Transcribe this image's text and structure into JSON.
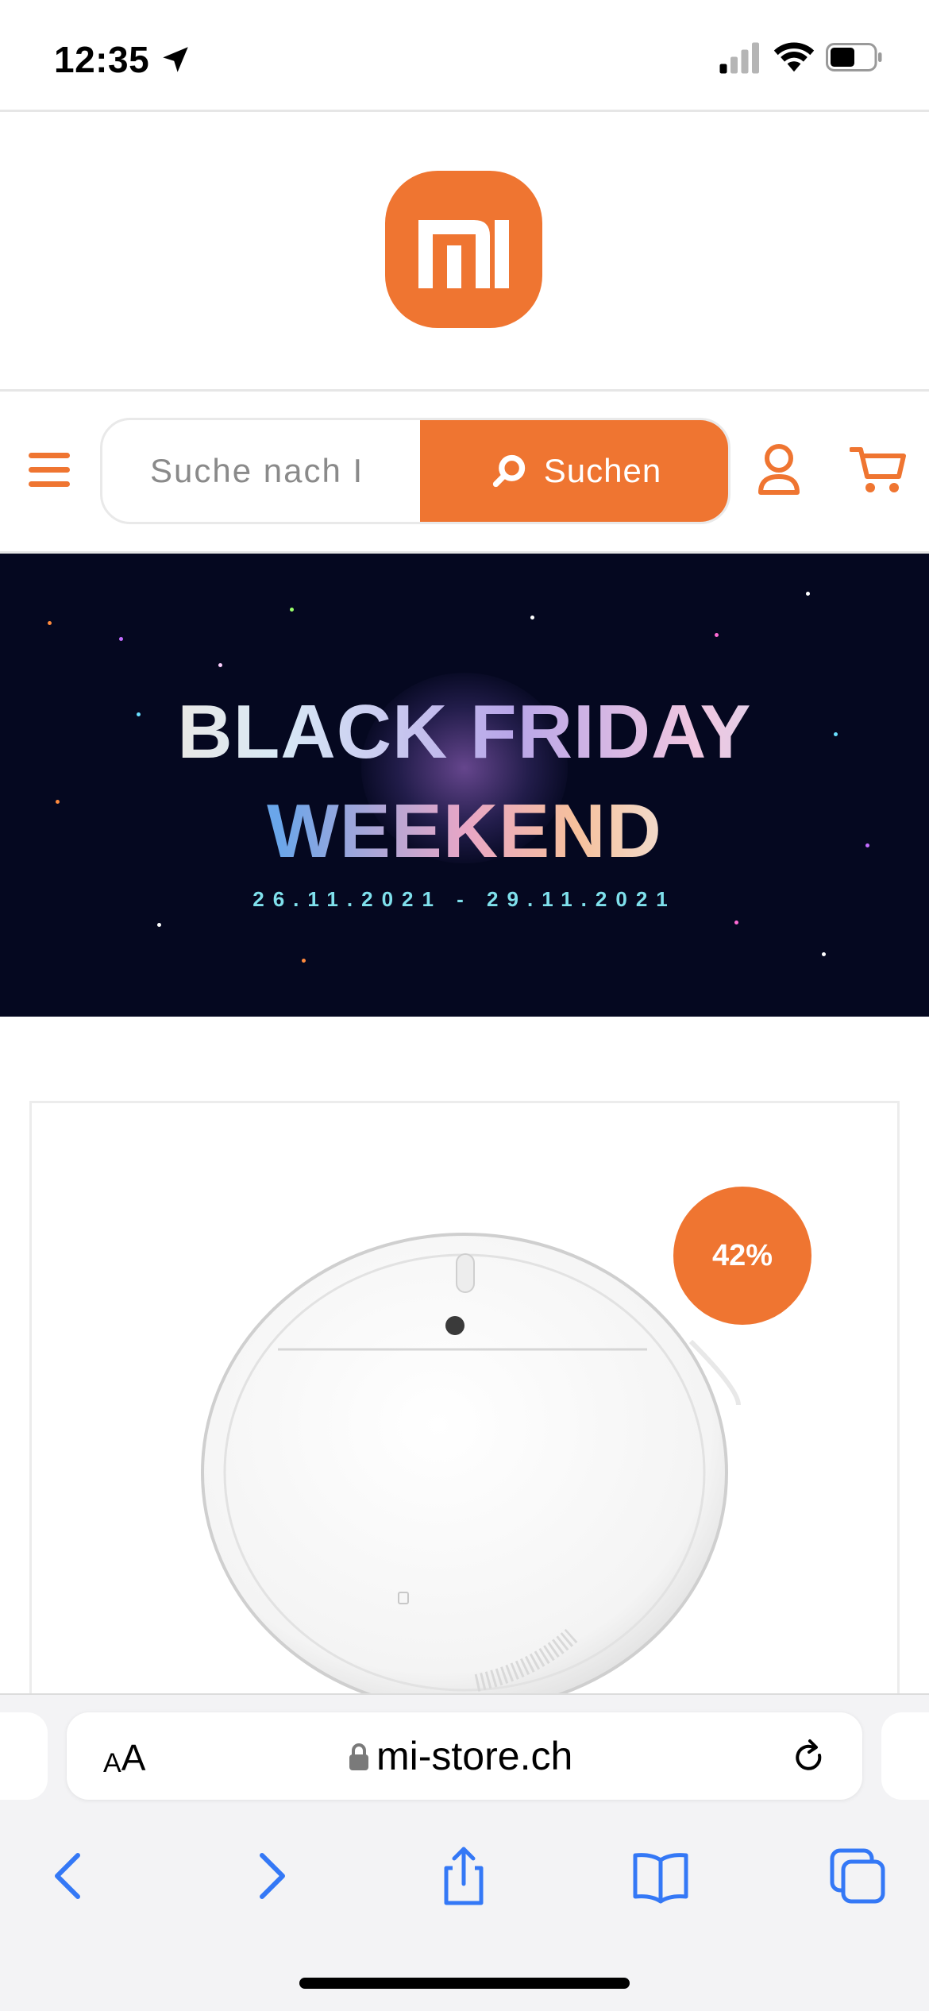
{
  "status_bar": {
    "time": "12:35",
    "icons": [
      "location-arrow-icon",
      "cellular-signal-icon",
      "wifi-icon",
      "battery-icon"
    ]
  },
  "brand": {
    "logo_text": "mi",
    "accent_color": "#ef7531"
  },
  "nav": {
    "menu_icon": "hamburger-icon",
    "search_placeholder": "Suche nach I",
    "search_button_label": "Suchen",
    "search_icon": "magnifier-icon",
    "account_icon": "user-icon",
    "cart_icon": "cart-icon"
  },
  "hero": {
    "title_line1": "BLACK FRIDAY",
    "title_line2": "WEEKEND",
    "dates": "26.11.2021 - 29.11.2021",
    "background_color": "#050820"
  },
  "product": {
    "discount_badge": "42%",
    "image": "robot-vacuum-cleaner"
  },
  "browser": {
    "aa_small": "A",
    "aa_large": "A",
    "url": "mi-store.ch",
    "toolbar_icons": [
      "back-icon",
      "forward-icon",
      "share-icon",
      "bookmarks-icon",
      "tabs-icon"
    ],
    "tint_color": "#3478f6"
  }
}
